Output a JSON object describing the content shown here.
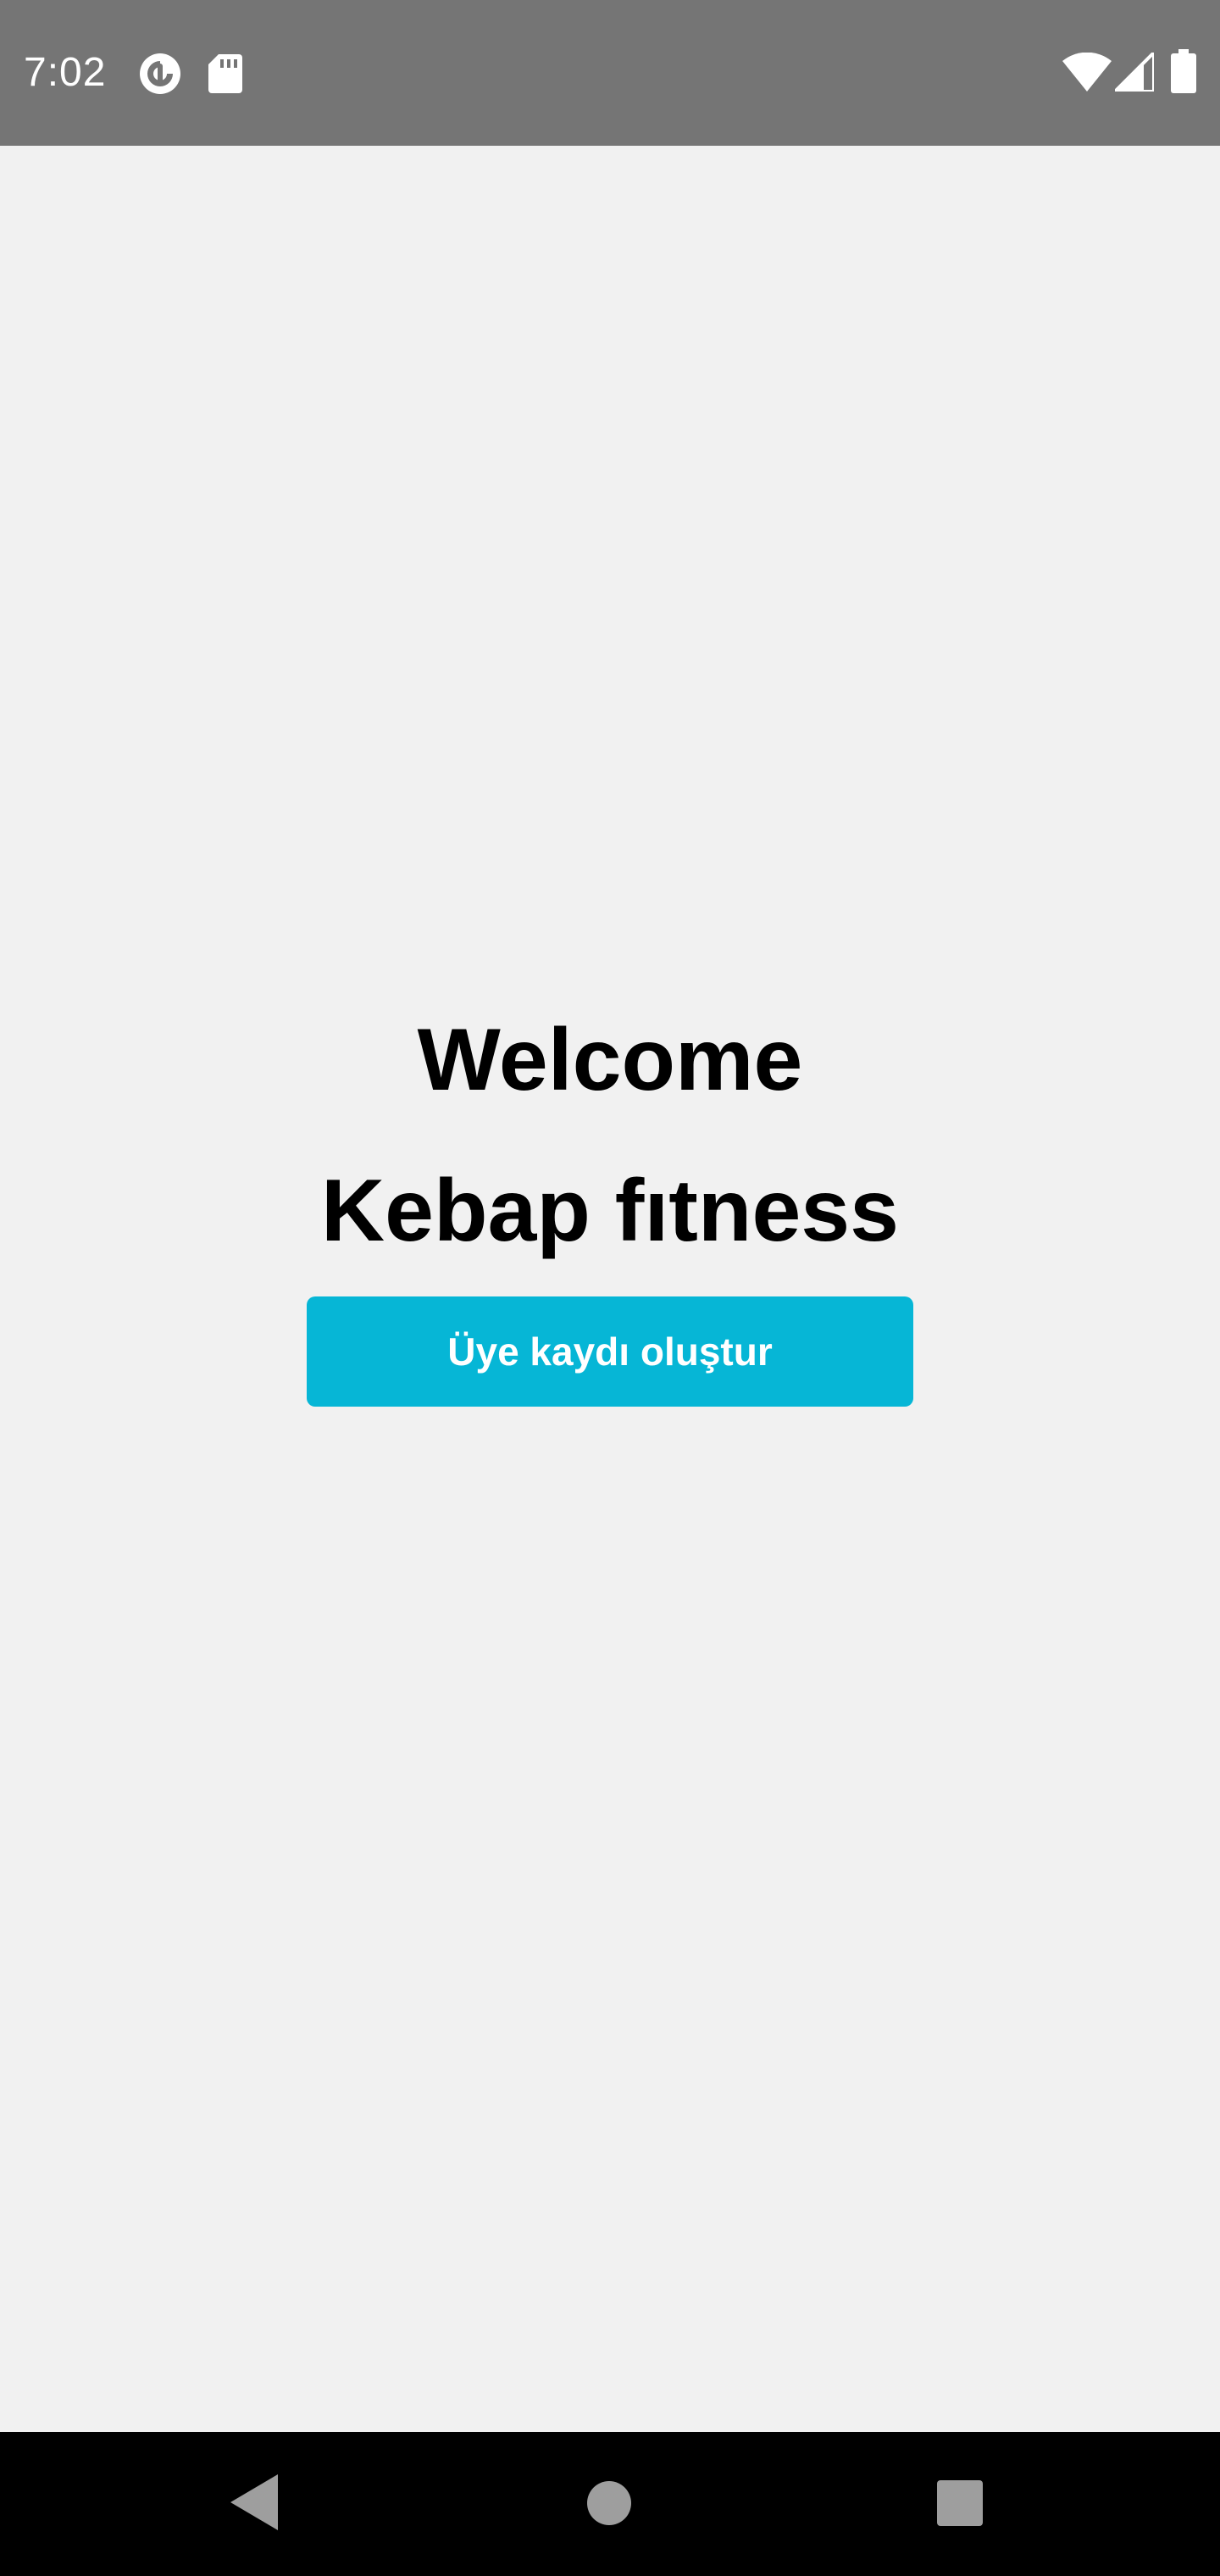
{
  "status_bar": {
    "time": "7:02",
    "icons": [
      "pocket-casts-icon",
      "sd-card-icon",
      "wifi-icon",
      "cell-signal-icon",
      "battery-icon"
    ]
  },
  "main": {
    "title": "Welcome",
    "app_name": "Kebap fıtness",
    "register_button_label": "Üye kaydı oluştur"
  },
  "nav_bar": {
    "buttons": [
      "back",
      "home",
      "recents"
    ]
  },
  "colors": {
    "status_bar_bg": "#757575",
    "background": "#f1f1f1",
    "accent": "#06b6d6",
    "nav_bar_bg": "#000000"
  }
}
